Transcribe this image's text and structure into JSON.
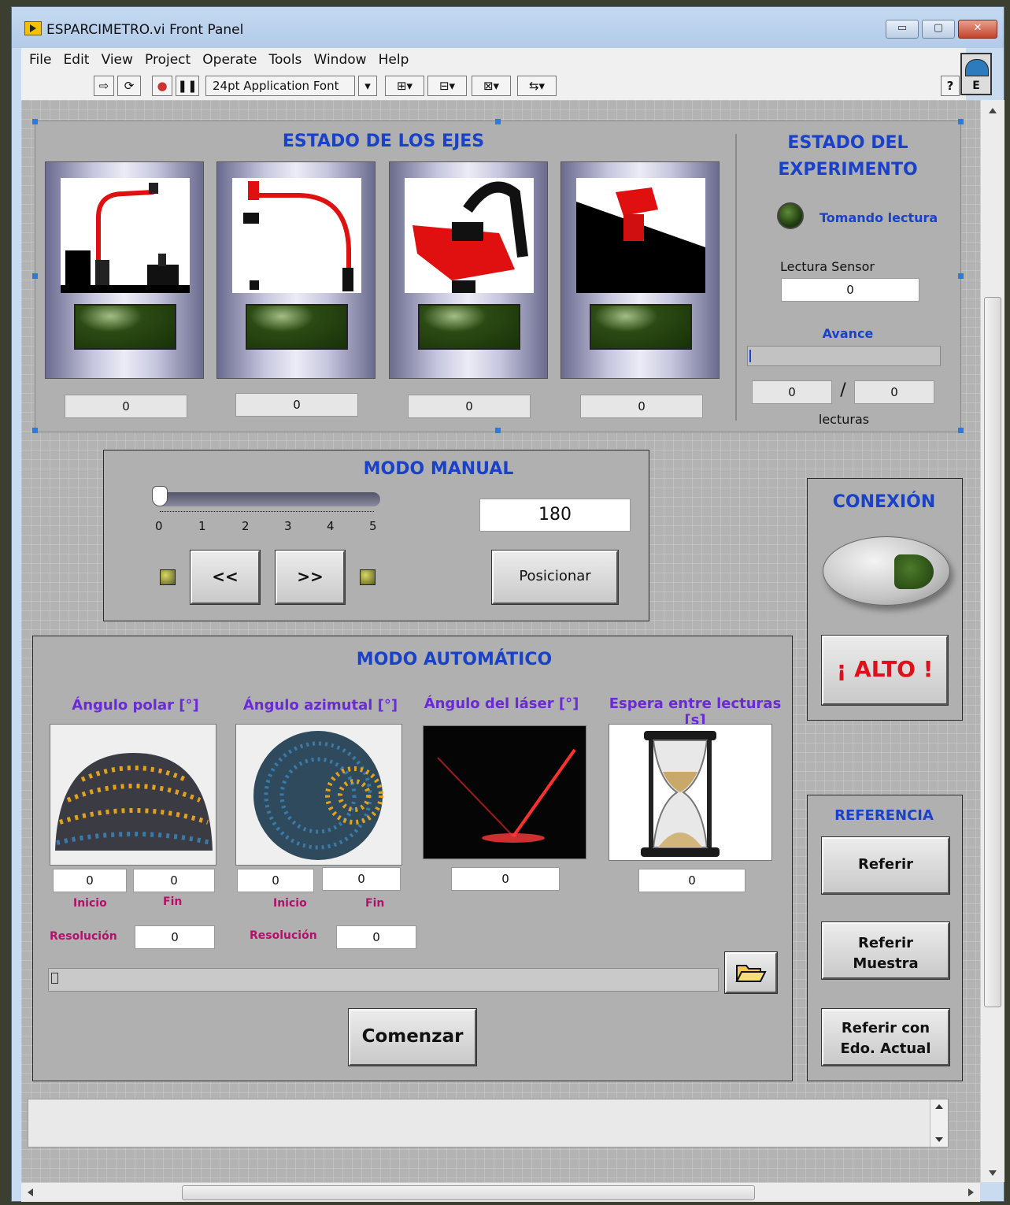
{
  "window": {
    "title": "ESPARCIMETRO.vi Front Panel",
    "controls": [
      "▭",
      "▢",
      "✕"
    ]
  },
  "menu": [
    "File",
    "Edit",
    "View",
    "Project",
    "Operate",
    "Tools",
    "Window",
    "Help"
  ],
  "toolbar": {
    "run": "⇨",
    "run_continuous": "⟳",
    "abort": "●",
    "pause": "❚❚",
    "font": "24pt Application Font",
    "font_arrow": "▾",
    "align": "⊞▾",
    "distribute": "⊟▾",
    "resize": "⊠▾",
    "reorder": "⇆▾",
    "help": "?"
  },
  "vi_icon_letter": "E",
  "estado_ejes": {
    "title": "ESTADO DE LOS EJES",
    "axes": [
      {
        "value": "0"
      },
      {
        "value": "0"
      },
      {
        "value": "0"
      },
      {
        "value": "0"
      }
    ]
  },
  "estado_experimento": {
    "title_line1": "ESTADO DEL",
    "title_line2": "EXPERIMENTO",
    "led_label": "Tomando lectura",
    "sensor_label": "Lectura Sensor",
    "sensor_value": "0",
    "avance_label": "Avance",
    "avance_progress": 0,
    "count_done": "0",
    "count_sep": "/",
    "count_total": "0",
    "count_unit": "lecturas"
  },
  "modo_manual": {
    "title": "MODO MANUAL",
    "slider_value": 0,
    "slider_ticks": [
      "0",
      "1",
      "2",
      "3",
      "4",
      "5"
    ],
    "position_value": "180",
    "back_label": "<<",
    "forward_label": ">>",
    "position_button": "Posicionar"
  },
  "conexion": {
    "title": "CONEXIÓN",
    "stop_label": "¡ ALTO !"
  },
  "modo_automatico": {
    "title": "MODO AUTOMÁTICO",
    "polar": {
      "label": "Ángulo polar [°]",
      "inicio": "0",
      "fin": "0",
      "resolucion": "0"
    },
    "azimutal": {
      "label": "Ángulo azimutal [°]",
      "inicio": "0",
      "fin": "0",
      "resolucion": "0"
    },
    "laser": {
      "label": "Ángulo del láser [°]",
      "value": "0"
    },
    "espera": {
      "label": "Espera entre lecturas [s]",
      "value": "0"
    },
    "inicio_label": "Inicio",
    "fin_label": "Fin",
    "resolucion_label": "Resolución",
    "path_value": "",
    "start_button": "Comenzar"
  },
  "referencia": {
    "title": "REFERENCIA",
    "b1": "Referir",
    "b2_line1": "Referir",
    "b2_line2": "Muestra",
    "b3_line1": "Referir con",
    "b3_line2": "Edo. Actual"
  },
  "colors": {
    "heading": "#1a42c8",
    "label_magenta": "#b2116b",
    "label_purple": "#6a2ad6",
    "stop_red": "#e0101a"
  }
}
